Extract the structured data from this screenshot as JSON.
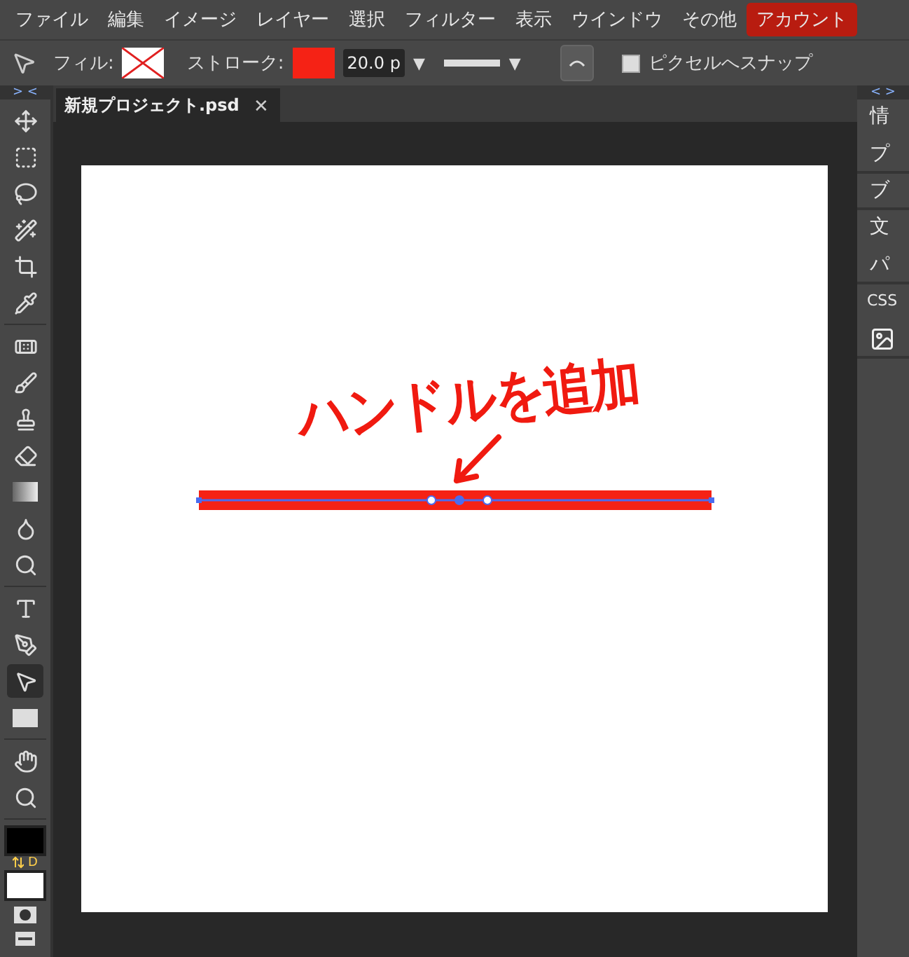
{
  "menu": [
    {
      "label": "ファイル",
      "highlighted": false
    },
    {
      "label": "編集",
      "highlighted": false
    },
    {
      "label": "イメージ",
      "highlighted": false
    },
    {
      "label": "レイヤー",
      "highlighted": false
    },
    {
      "label": "選択",
      "highlighted": false
    },
    {
      "label": "フィルター",
      "highlighted": false
    },
    {
      "label": "表示",
      "highlighted": false
    },
    {
      "label": "ウインドウ",
      "highlighted": false
    },
    {
      "label": "その他",
      "highlighted": false
    },
    {
      "label": "アカウント",
      "highlighted": true
    }
  ],
  "options": {
    "fill_label": "フィル:",
    "paints": [
      {
        "kind": "fill",
        "none": true
      },
      {
        "kind": "stroke",
        "color": "#f52215"
      }
    ],
    "stroke_label": "ストローク:",
    "stroke_width": "20.0 p",
    "width_arrow": "▼",
    "style_arrow": "▼",
    "snap": {
      "label": "ピクセルへスナップ",
      "checked": false
    }
  },
  "left_toggle": "> <",
  "tools": [
    [
      {
        "kind": "move",
        "selected": false
      },
      {
        "kind": "marquee",
        "selected": false
      },
      {
        "kind": "lasso",
        "selected": false
      },
      {
        "kind": "quick",
        "selected": false
      },
      {
        "kind": "crop",
        "selected": false
      },
      {
        "kind": "eyedropper",
        "selected": false
      }
    ],
    [
      {
        "kind": "heal",
        "selected": false
      },
      {
        "kind": "brush",
        "selected": false
      },
      {
        "kind": "stamp",
        "selected": false
      },
      {
        "kind": "eraser",
        "selected": false
      },
      {
        "kind": "gradient",
        "selected": false
      },
      {
        "kind": "blur",
        "selected": false
      },
      {
        "kind": "dodge",
        "selected": false
      }
    ],
    [
      {
        "kind": "type",
        "selected": false
      },
      {
        "kind": "pen",
        "selected": false
      },
      {
        "kind": "direct",
        "selected": true
      },
      {
        "kind": "shape",
        "selected": false
      }
    ],
    [
      {
        "kind": "hand",
        "selected": false
      },
      {
        "kind": "zoom",
        "selected": false
      }
    ]
  ],
  "swatches": [
    {
      "color": "#000000"
    },
    {
      "color": "#ffffff"
    }
  ],
  "swatch_default": "D",
  "tab": {
    "title": "新規プロジェクト.psd",
    "close": "✕"
  },
  "canvas": {
    "annotation": "ハンドルを追加"
  },
  "right_toggle": "< >",
  "panels": [
    [
      {
        "kind": "text",
        "label": "情"
      },
      {
        "kind": "text",
        "label": "プ"
      }
    ],
    [
      {
        "kind": "text",
        "label": "ブ"
      }
    ],
    [
      {
        "kind": "text",
        "label": "文"
      },
      {
        "kind": "text",
        "label": "パ"
      }
    ],
    [
      {
        "kind": "text",
        "label": "CSS"
      },
      {
        "kind": "image"
      }
    ]
  ]
}
